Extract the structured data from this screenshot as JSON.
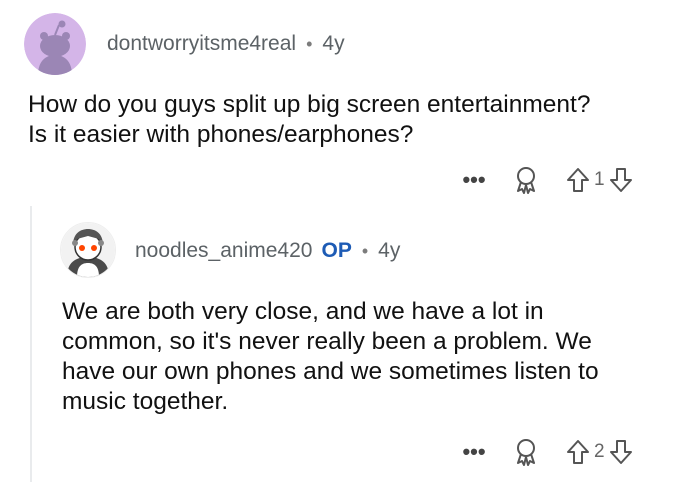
{
  "comment": {
    "username": "dontworryitsme4real",
    "separator": "•",
    "age": "4y",
    "lines": [
      "How do you guys split up big screen entertainment?",
      "Is it easier with phones/earphones?"
    ],
    "votes": "1",
    "icons": {
      "more": "more-options-icon",
      "award": "award-icon",
      "upvote": "upvote-arrow-icon",
      "downvote": "downvote-arrow-icon"
    }
  },
  "reply": {
    "username": "noodles_anime420",
    "op_badge": "OP",
    "separator": "•",
    "age": "4y",
    "lines": [
      "We are both very close, and we have a lot in",
      "common, so it's never really been a problem. We",
      "have our own phones and we sometimes listen to",
      "music together."
    ],
    "votes": "2"
  },
  "colors": {
    "avatar1_bg": "#d4b5e8",
    "op": "#1d5bb5",
    "meta": "#5c6266"
  }
}
